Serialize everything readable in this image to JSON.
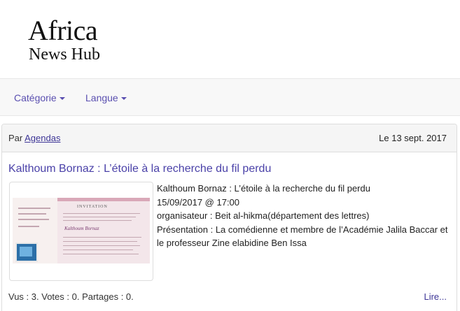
{
  "header": {
    "logo_line1": "Africa",
    "logo_line2": "News Hub"
  },
  "navbar": {
    "items": [
      {
        "label": "Catégorie"
      },
      {
        "label": "Langue"
      }
    ],
    "accent_color": "#5a4fb0"
  },
  "article": {
    "by_prefix": "Par",
    "author": "Agendas",
    "date": "Le 13 sept. 2017",
    "title": "Kalthoum Bornaz : L’étoile à la recherche du fil perdu",
    "body_lines": [
      "Kalthoum Bornaz : L’étoile à la recherche du fil perdu",
      "15/09/2017 @ 17:00",
      "organisateur : Beit al-hikma(département des lettres)",
      "Présentation : La comédienne et membre de l’Académie Jalila Baccar et le professeur Zine elabidine Ben Issa"
    ],
    "thumbnail": {
      "heading": "INVITATION",
      "name": "Kalthoum Bornaz"
    },
    "stats": {
      "views_label": "Vus : 3.",
      "votes_label": "Votes : 0.",
      "shares_label": "Partages : 0."
    },
    "read_more": "Lire..."
  }
}
